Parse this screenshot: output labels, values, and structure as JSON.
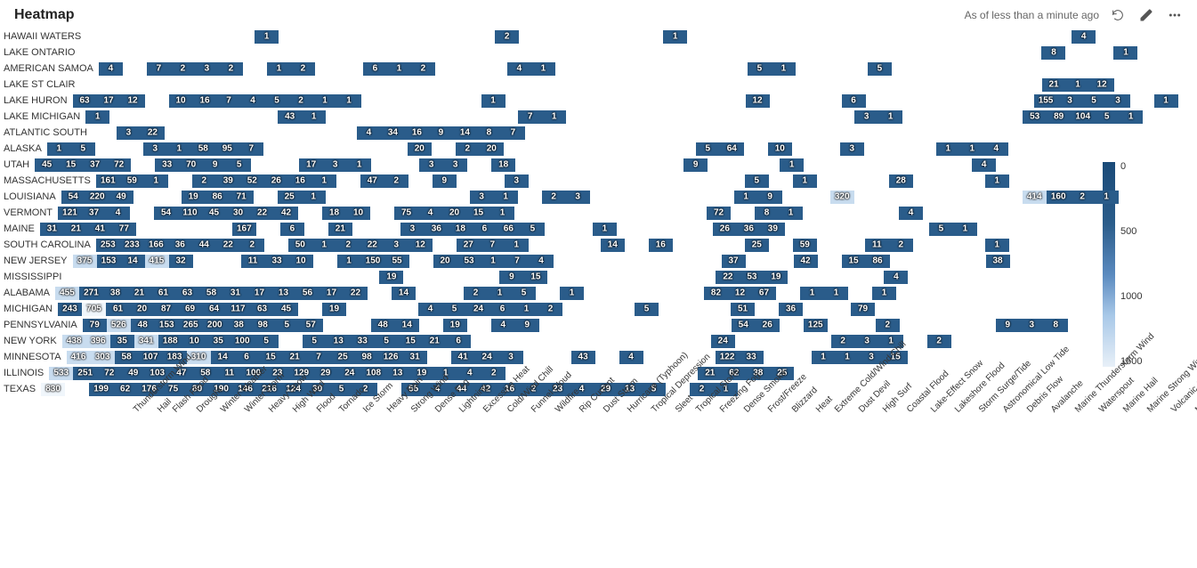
{
  "header": {
    "title": "Heatmap",
    "asof": "As of less than a minute ago"
  },
  "chart_data": {
    "type": "heatmap",
    "xlabel": "",
    "ylabel": "",
    "legend_ticks": [
      "0",
      "500",
      "1000",
      "1500"
    ],
    "x_categories": [
      "Thunderstorm Wind",
      "Hail",
      "Flash Flood",
      "Drought",
      "Winter Weather",
      "Winter Storm",
      "Heavy Snow",
      "High Wind",
      "Flood",
      "Tornado",
      "Ice Storm",
      "Heavy Rain",
      "Strong Wind",
      "Dense Fog",
      "Lightning",
      "Excessive Heat",
      "Cold/Wind Chill",
      "Funnel Cloud",
      "Wildfire",
      "Rip Current",
      "Dust Storm",
      "Hurricane (Typhoon)",
      "Tropical Depression",
      "Sleet",
      "Tropical Storm",
      "Freezing Fog",
      "Dense Smoke",
      "Frost/Freeze",
      "Blizzard",
      "Heat",
      "Extreme Cold/Wind Chill",
      "Dust Devil",
      "High Surf",
      "Coastal Flood",
      "Lake-Effect Snow",
      "Lakeshore Flood",
      "Storm Surge/Tide",
      "Astronomical Low Tide",
      "Debris Flow",
      "Avalanche",
      "Marine Thunderstorm Wind",
      "Waterspout",
      "Marine Hail",
      "Marine Strong Wind",
      "Volcanic Ash",
      "Marine High Wind"
    ],
    "y_categories": [
      "HAWAII WATERS",
      "LAKE ONTARIO",
      "AMERICAN SAMOA",
      "LAKE ST CLAIR",
      "LAKE HURON",
      "LAKE MICHIGAN",
      "ATLANTIC SOUTH",
      "ALASKA",
      "UTAH",
      "MASSACHUSETTS",
      "LOUISIANA",
      "VERMONT",
      "MAINE",
      "SOUTH CAROLINA",
      "NEW JERSEY",
      "MISSISSIPPI",
      "ALABAMA",
      "MICHIGAN",
      "PENNSYLVANIA",
      "NEW YORK",
      "MINNESOTA",
      "ILLINOIS",
      "TEXAS"
    ],
    "rows": [
      {
        "y": "HAWAII WATERS",
        "cells": {
          "High Wind": 1,
          "Funnel Cloud": 2,
          "Tropical Storm": 1,
          "Waterspout": 4
        }
      },
      {
        "y": "LAKE ONTARIO",
        "cells": {
          "Marine Thunderstorm Wind": 8,
          "Marine Strong Wind": 1
        }
      },
      {
        "y": "AMERICAN SAMOA",
        "cells": {
          "Thunderstorm Wind": 4,
          "Flash Flood": 7,
          "Drought": 2,
          "Winter Weather": 3,
          "Winter Storm": 2,
          "High Wind": 1,
          "Flood": 2,
          "Heavy Rain": 6,
          "Strong Wind": 1,
          "Dense Fog": 2,
          "Funnel Cloud": 4,
          "Wildfire": 1,
          "Frost/Freeze": 5,
          "Blizzard": 1,
          "High Surf": 5
        }
      },
      {
        "y": "LAKE ST CLAIR",
        "cells": {
          "Marine Thunderstorm Wind": 21,
          "Waterspout": 1,
          "Marine Hail": 12
        }
      },
      {
        "y": "LAKE HURON",
        "cells": {
          "Thunderstorm Wind": 63,
          "Hail": 17,
          "Flash Flood": 12,
          "Winter Weather": 10,
          "Winter Storm": 16,
          "Heavy Snow": 7,
          "High Wind": 4,
          "Flood": 5,
          "Tornado": 2,
          "Ice Storm": 1,
          "Heavy Rain": 1,
          "Funnel Cloud": 1,
          "Blizzard": 12,
          "High Surf": 6,
          "Marine Thunderstorm Wind": 155,
          "Waterspout": 3,
          "Marine Hail": 5,
          "Marine Strong Wind": 3,
          "Marine High Wind": 1
        }
      },
      {
        "y": "LAKE MICHIGAN",
        "cells": {
          "Thunderstorm Wind": 1,
          "Flood": 43,
          "Tornado": 1,
          "Wildfire": 7,
          "Rip Current": 1,
          "High Surf": 3,
          "Coastal Flood": 1,
          "Avalanche": 53,
          "Marine Thunderstorm Wind": 89,
          "Waterspout": 104,
          "Marine Hail": 5,
          "Marine Strong Wind": 1
        }
      },
      {
        "y": "ATLANTIC SOUTH",
        "cells": {
          "Hail": 3,
          "Flash Flood": 22,
          "Heavy Rain": 4,
          "Strong Wind": 34,
          "Dense Fog": 16,
          "Lightning": 9,
          "Excessive Heat": 14,
          "Cold/Wind Chill": 8,
          "Funnel Cloud": 7
        }
      },
      {
        "y": "ALASKA",
        "cells": {
          "Thunderstorm Wind": 1,
          "Hail": 5,
          "Winter Weather": 3,
          "Winter Storm": 1,
          "Heavy Snow": 58,
          "High Wind": 95,
          "Flood": 7,
          "Excessive Heat": 20,
          "Funnel Cloud": 2,
          "Wildfire": 20,
          "Frost/Freeze": 5,
          "Blizzard": 64,
          "Extreme Cold/Wind Chill": 10,
          "Coastal Flood": 3,
          "Astronomical Low Tide": 1,
          "Debris Flow": 1,
          "Avalanche": 4
        }
      },
      {
        "y": "UTAH",
        "cells": {
          "Thunderstorm Wind": 45,
          "Hail": 15,
          "Flash Flood": 37,
          "Drought": 72,
          "Winter Storm": 33,
          "Heavy Snow": 70,
          "High Wind": 9,
          "Flood": 5,
          "Heavy Rain": 17,
          "Strong Wind": 3,
          "Dense Fog": 1,
          "Cold/Wind Chill": 3,
          "Funnel Cloud": 3,
          "Rip Current": 18,
          "Frost/Freeze": 9,
          "Dust Devil": 1,
          "Avalanche": 4
        }
      },
      {
        "y": "MASSACHUSETTS",
        "cells": {
          "Thunderstorm Wind": 161,
          "Hail": 59,
          "Flash Flood": 1,
          "Winter Weather": 2,
          "Winter Storm": 39,
          "Heavy Snow": 52,
          "High Wind": 26,
          "Flood": 16,
          "Tornado": 1,
          "Heavy Rain": 47,
          "Strong Wind": 2,
          "Lightning": 9,
          "Funnel Cloud": 3,
          "Frost/Freeze": 5,
          "Heat": 1,
          "Coastal Flood": 28,
          "Astronomical Low Tide": 1
        }
      },
      {
        "y": "LOUISIANA",
        "cells": {
          "Thunderstorm Wind": 54,
          "Hail": 220,
          "Flash Flood": 49,
          "Winter Storm": 19,
          "Heavy Snow": 86,
          "High Wind": 71,
          "Tornado": 25,
          "Ice Storm": 1,
          "Funnel Cloud": 3,
          "Wildfire": 1,
          "Dust Storm": 2,
          "Hurricane (Typhoon)": 3,
          "Blizzard": 1,
          "Heat": 9,
          "High Surf": 320,
          "Marine Thunderstorm Wind": 414,
          "Waterspout": 160,
          "Marine Hail": 2,
          "Marine Strong Wind": 1
        }
      },
      {
        "y": "VERMONT",
        "cells": {
          "Thunderstorm Wind": 121,
          "Hail": 37,
          "Flash Flood": 4,
          "Winter Weather": 54,
          "Winter Storm": 110,
          "Heavy Snow": 45,
          "High Wind": 30,
          "Flood": 22,
          "Tornado": 42,
          "Heavy Rain": 18,
          "Strong Wind": 10,
          "Lightning": 75,
          "Excessive Heat": 4,
          "Cold/Wind Chill": 20,
          "Funnel Cloud": 15,
          "Wildfire": 1,
          "Frost/Freeze": 72,
          "Heat": 8,
          "Extreme Cold/Wind Chill": 1,
          "Lakeshore Flood": 4
        }
      },
      {
        "y": "MAINE",
        "cells": {
          "Thunderstorm Wind": 31,
          "Hail": 21,
          "Flash Flood": 41,
          "Drought": 77,
          "Flood": 167,
          "Ice Storm": 6,
          "Strong Wind": 21,
          "Excessive Heat": 3,
          "Cold/Wind Chill": 36,
          "Funnel Cloud": 18,
          "Wildfire": 6,
          "Rip Current": 66,
          "Dust Storm": 5,
          "Sleet": 1,
          "Blizzard": 26,
          "Heat": 36,
          "Extreme Cold/Wind Chill": 39,
          "Astronomical Low Tide": 5,
          "Debris Flow": 1
        }
      },
      {
        "y": "SOUTH CAROLINA",
        "cells": {
          "Thunderstorm Wind": 253,
          "Hail": 233,
          "Flash Flood": 166,
          "Drought": 36,
          "Winter Weather": 44,
          "Winter Storm": 22,
          "Heavy Snow": 2,
          "Flood": 50,
          "Tornado": 1,
          "Ice Storm": 2,
          "Heavy Rain": 22,
          "Strong Wind": 3,
          "Dense Fog": 12,
          "Excessive Heat": 27,
          "Cold/Wind Chill": 7,
          "Funnel Cloud": 1,
          "Hurricane (Typhoon)": 14,
          "Sleet": 16,
          "Frost/Freeze": 25,
          "Heat": 59,
          "High Surf": 11,
          "Coastal Flood": 2,
          "Astronomical Low Tide": 1
        }
      },
      {
        "y": "NEW JERSEY",
        "cells": {
          "Thunderstorm Wind": 375,
          "Hail": 153,
          "Flash Flood": 14,
          "Drought": 415,
          "Winter Weather": 32,
          "High Wind": 11,
          "Flood": 33,
          "Tornado": 10,
          "Heavy Rain": 1,
          "Strong Wind": 150,
          "Dense Fog": 55,
          "Excessive Heat": 20,
          "Cold/Wind Chill": 53,
          "Funnel Cloud": 1,
          "Wildfire": 7,
          "Rip Current": 4,
          "Frost/Freeze": 37,
          "Extreme Cold/Wind Chill": 42,
          "High Surf": 15,
          "Coastal Flood": 86,
          "Debris Flow": 38
        }
      },
      {
        "y": "MISSISSIPPI",
        "cells": {
          "Dense Fog": 19,
          "Wildfire": 9,
          "Rip Current": 15,
          "Frost/Freeze": 22,
          "Blizzard": 53,
          "Heat": 19,
          "Lake-Effect Snow": 4
        }
      },
      {
        "y": "ALABAMA",
        "cells": {
          "Thunderstorm Wind": 455,
          "Hail": 271,
          "Flash Flood": 38,
          "Drought": 21,
          "Winter Weather": 61,
          "Winter Storm": 63,
          "Heavy Snow": 58,
          "High Wind": 31,
          "Flood": 17,
          "Tornado": 13,
          "Ice Storm": 56,
          "Heavy Rain": 17,
          "Strong Wind": 22,
          "Lightning": 14,
          "Funnel Cloud": 2,
          "Wildfire": 1,
          "Rip Current": 5,
          "Hurricane (Typhoon)": 1,
          "Frost/Freeze": 82,
          "Blizzard": 12,
          "Heat": 67,
          "Dust Devil": 1,
          "High Surf": 1,
          "Lake-Effect Snow": 1
        }
      },
      {
        "y": "MICHIGAN",
        "cells": {
          "Thunderstorm Wind": 243,
          "Hail": 705,
          "Flash Flood": 61,
          "Drought": 20,
          "Winter Weather": 87,
          "Winter Storm": 69,
          "Heavy Snow": 64,
          "High Wind": 117,
          "Flood": 63,
          "Tornado": 45,
          "Heavy Rain": 19,
          "Excessive Heat": 4,
          "Cold/Wind Chill": 5,
          "Funnel Cloud": 24,
          "Wildfire": 6,
          "Rip Current": 1,
          "Dust Storm": 2,
          "Tropical Storm": 5,
          "Blizzard": 51,
          "Extreme Cold/Wind Chill": 36,
          "Coastal Flood": 79
        }
      },
      {
        "y": "PENNSYLVANIA",
        "cells": {
          "Thunderstorm Wind": 79,
          "Hail": 526,
          "Flash Flood": 48,
          "Drought": 153,
          "Winter Weather": 265,
          "Winter Storm": 200,
          "Heavy Snow": 38,
          "High Wind": 98,
          "Flood": 5,
          "Tornado": 57,
          "Strong Wind": 48,
          "Dense Fog": 14,
          "Excessive Heat": 19,
          "Funnel Cloud": 4,
          "Wildfire": 9,
          "Frost/Freeze": 54,
          "Blizzard": 26,
          "Extreme Cold/Wind Chill": 125,
          "Coastal Flood": 2,
          "Debris Flow": 9,
          "Avalanche": 3,
          "Marine Thunderstorm Wind": 8
        }
      },
      {
        "y": "NEW YORK",
        "cells": {
          "Thunderstorm Wind": 438,
          "Hail": 396,
          "Flash Flood": 35,
          "Drought": 341,
          "Winter Weather": 188,
          "Winter Storm": 10,
          "Heavy Snow": 35,
          "High Wind": 100,
          "Flood": 5,
          "Ice Storm": 5,
          "Heavy Rain": 13,
          "Strong Wind": 33,
          "Dense Fog": 5,
          "Lightning": 15,
          "Excessive Heat": 21,
          "Cold/Wind Chill": 6,
          "Frost/Freeze": 24,
          "High Surf": 2,
          "Coastal Flood": 3,
          "Lake-Effect Snow": 1,
          "Storm Surge/Tide": 2
        }
      },
      {
        "y": "MINNESOTA",
        "cells": {
          "Thunderstorm Wind": 416,
          "Hail": 303,
          "Flash Flood": 58,
          "Drought": 107,
          "Winter Weather": 183,
          "Winter Storm": 310,
          "Heavy Snow": 14,
          "High Wind": 6,
          "Flood": 15,
          "Tornado": 21,
          "Ice Storm": 7,
          "Heavy Rain": 25,
          "Strong Wind": 98,
          "Dense Fog": 126,
          "Lightning": 31,
          "Cold/Wind Chill": 41,
          "Funnel Cloud": 24,
          "Wildfire": 3,
          "Hurricane (Typhoon)": 43,
          "Sleet": 4,
          "Frost/Freeze": 122,
          "Blizzard": 33,
          "Dust Devil": 1,
          "High Surf": 1,
          "Coastal Flood": 3,
          "Lake-Effect Snow": 15
        }
      },
      {
        "y": "ILLINOIS",
        "cells": {
          "Thunderstorm Wind": 533,
          "Hail": 251,
          "Flash Flood": 72,
          "Drought": 49,
          "Winter Weather": 103,
          "Winter Storm": 47,
          "Heavy Snow": 58,
          "High Wind": 11,
          "Flood": 100,
          "Tornado": 23,
          "Ice Storm": 129,
          "Heavy Rain": 29,
          "Strong Wind": 24,
          "Dense Fog": 108,
          "Lightning": 13,
          "Excessive Heat": 19,
          "Cold/Wind Chill": 1,
          "Funnel Cloud": 4,
          "Wildfire": 2,
          "Frost/Freeze": 21,
          "Blizzard": 62,
          "Heat": 38,
          "Extreme Cold/Wind Chill": 25
        }
      },
      {
        "y": "TEXAS",
        "cells": {
          "Thunderstorm Wind": 830,
          "Flash Flood": 199,
          "Drought": 62,
          "Winter Weather": 176,
          "Winter Storm": 75,
          "Heavy Snow": 80,
          "High Wind": 190,
          "Flood": 146,
          "Tornado": 216,
          "Ice Storm": 124,
          "Heavy Rain": 30,
          "Strong Wind": 5,
          "Dense Fog": 2,
          "Excessive Heat": 55,
          "Cold/Wind Chill": 4,
          "Funnel Cloud": 44,
          "Wildfire": 42,
          "Rip Current": 16,
          "Dust Storm": 2,
          "Hurricane (Typhoon)": 23,
          "Tropical Depression": 4,
          "Sleet": 29,
          "Tropical Storm": 13,
          "Freezing Fog": 5,
          "Frost/Freeze": 2,
          "Blizzard": 1
        }
      }
    ]
  }
}
